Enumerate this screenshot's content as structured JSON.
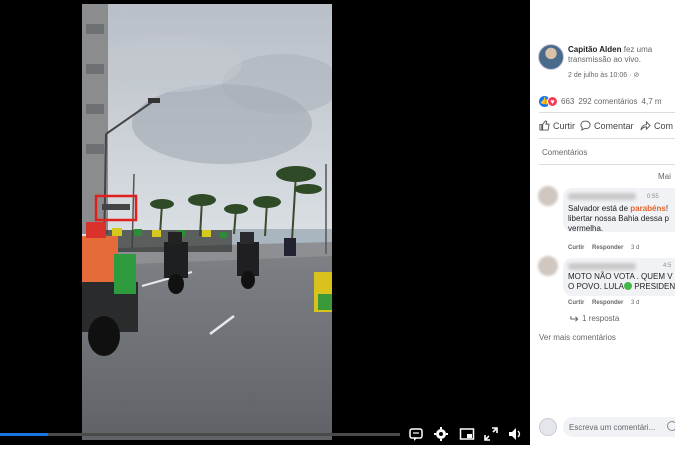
{
  "video": {
    "progress": 0.12,
    "controls": [
      "captions-icon",
      "settings-icon",
      "pip-icon",
      "fullscreen-icon",
      "volume-icon"
    ]
  },
  "post": {
    "author": "Capitão Alden",
    "action_text": "fez uma transmissão ao vivo.",
    "date": "2 de julho às 10:06 · ⊘",
    "reaction_count": "663",
    "comment_count": "292 comentários",
    "view_count": "4,7 m",
    "actions": {
      "like": "Curtir",
      "comment": "Comentar",
      "share": "Com"
    }
  },
  "comments_panel": {
    "section_label": "Comentários",
    "sort_label": "Mai",
    "comments": [
      {
        "time": "0:55",
        "line1_prefix": "Salvador está de ",
        "line1_highlight": "parabéns",
        "line1_suffix": "!",
        "line2": "libertar nossa Bahia dessa p",
        "line3": "vermelha.",
        "like": "Curtir",
        "reply": "Responder",
        "age": "3 d"
      },
      {
        "time": "4:5",
        "line1": "MOTO NÃO VOTA . QUEM V",
        "line2_prefix": "O POVO. LULA",
        "line2_suffix": " PRESIDEN",
        "like": "Curtir",
        "reply": "Responder",
        "age": "3 d"
      }
    ],
    "replies_label": "1 resposta",
    "more_comments": "Ver mais comentários",
    "composer_placeholder": "Escreva um comentári..."
  },
  "colors": {
    "accent": "#1877f2",
    "highlight": "#e4632c",
    "annotation_box": "#e0201c"
  }
}
